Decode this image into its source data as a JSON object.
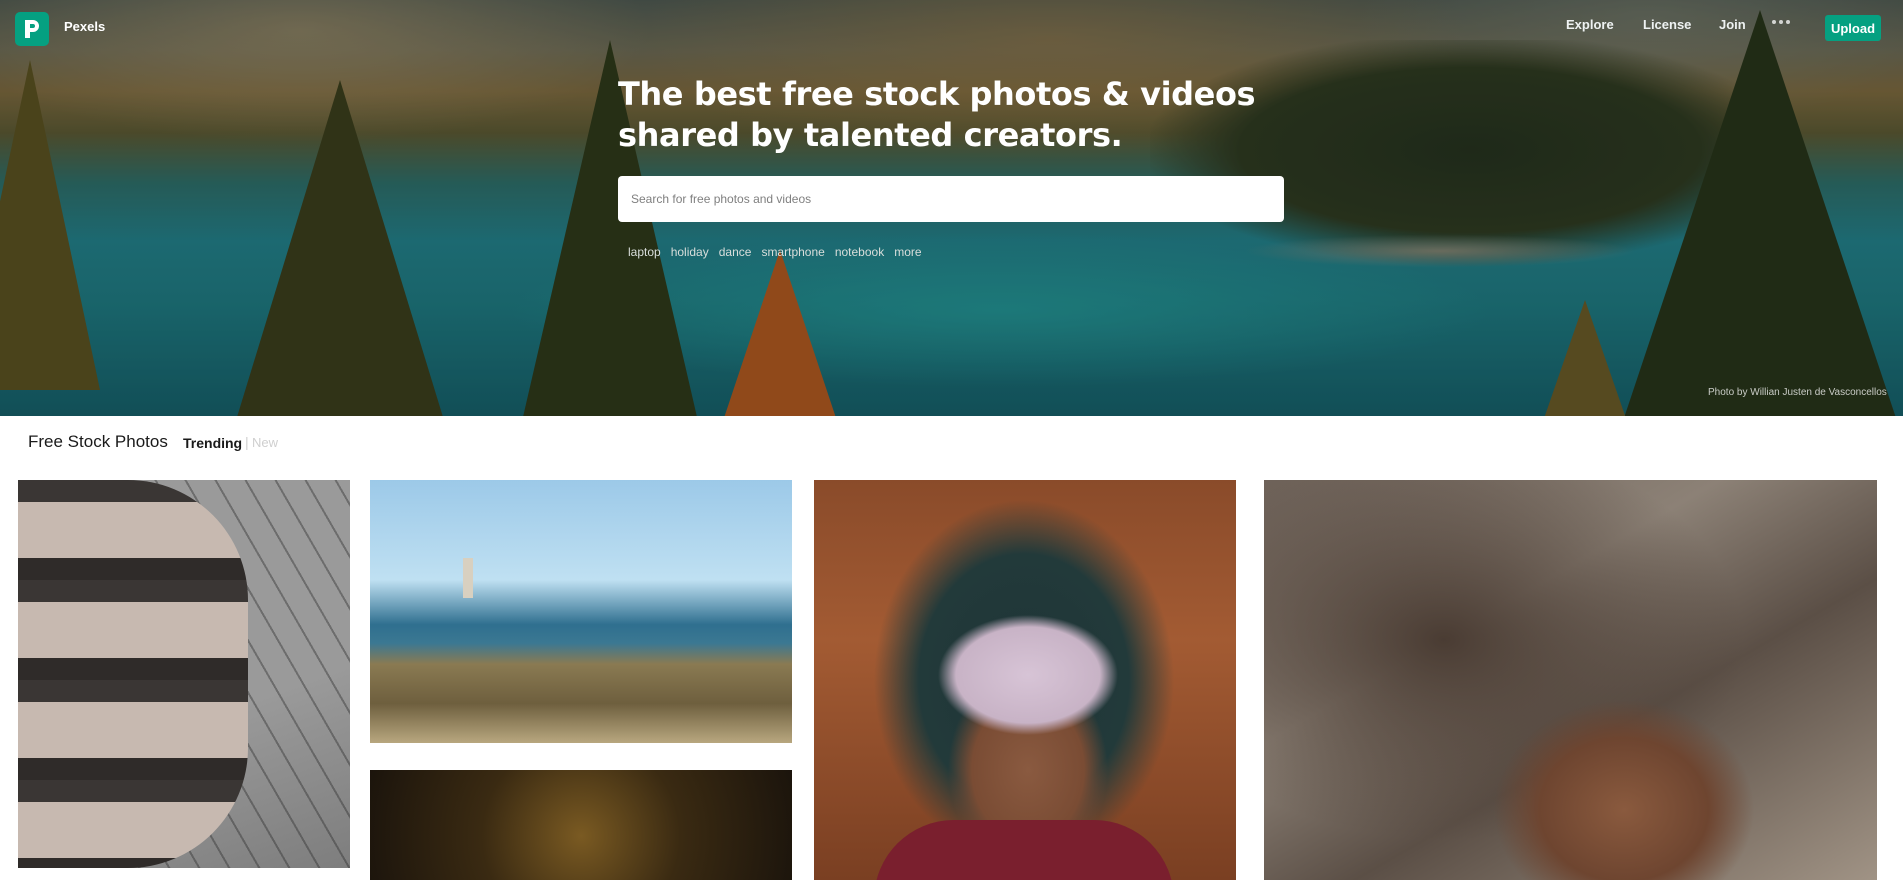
{
  "nav": {
    "brand": "Pexels",
    "links": [
      {
        "label": "Explore"
      },
      {
        "label": "License"
      },
      {
        "label": "Join"
      }
    ],
    "upload_label": "Upload"
  },
  "hero": {
    "headline": "The best free stock photos & videos shared by talented creators.",
    "search_placeholder": "Search for free photos and videos",
    "tags": [
      "laptop",
      "holiday",
      "dance",
      "smartphone",
      "notebook",
      "more"
    ],
    "photo_credit": "Photo by Willian Justen de Vasconcellos"
  },
  "section": {
    "title": "Free Stock Photos",
    "filter_active": "Trending",
    "filter_separator": "|",
    "filter_inactive": "New"
  },
  "colors": {
    "brand_green": "#05a081",
    "text_dark": "#1a1a1a",
    "muted": "#cfcfcf"
  },
  "icons": {
    "logo": "pexels-logo-icon",
    "more": "more-dots-icon"
  }
}
